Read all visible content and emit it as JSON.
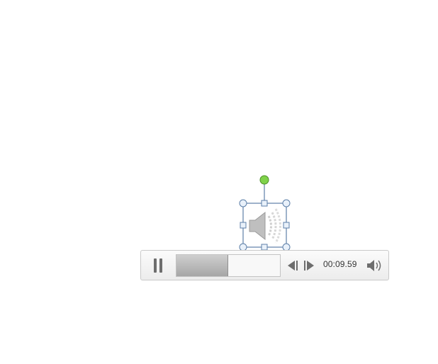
{
  "speaker_object": {
    "icon": "speaker-icon",
    "selected": true
  },
  "player": {
    "play_state": "playing",
    "pause_icon": "pause-icon",
    "progress_fraction": 0.49,
    "skip_back_icon": "skip-back-icon",
    "skip_forward_icon": "skip-forward-icon",
    "elapsed_time": "00:09.59",
    "volume_icon": "volume-icon"
  },
  "colors": {
    "rotation_handle": "#7fd24a",
    "selection_border": "#5d7fa8",
    "handle_fill": "#e9f1fa"
  }
}
